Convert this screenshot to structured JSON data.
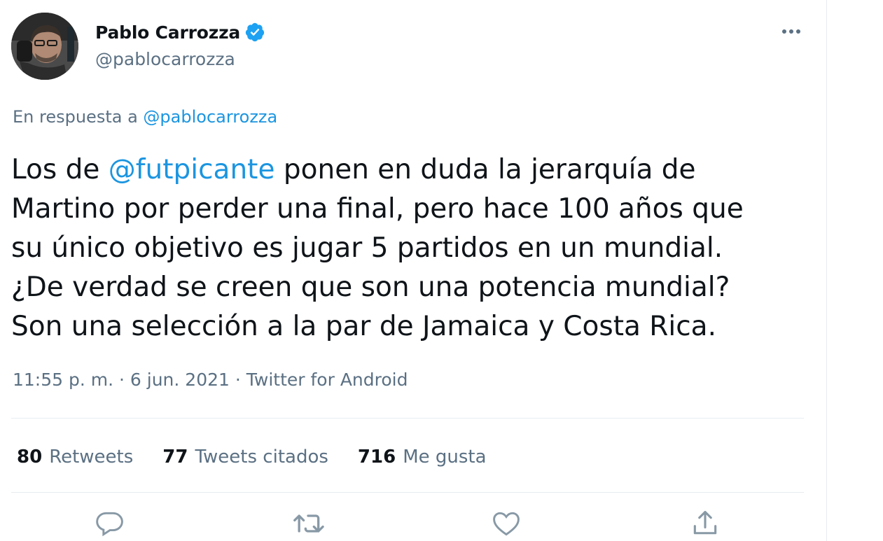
{
  "author": {
    "display_name": "Pablo Carrozza",
    "handle": "@pablocarrozza",
    "verified": true,
    "avatar_icon": "profile-photo"
  },
  "reply": {
    "prefix": "En respuesta a",
    "target": "@pablocarrozza"
  },
  "tweet": {
    "line1_before": "Los de ",
    "line1_mention": "@futpicante",
    "line1_after": " ponen en duda la jerarquía de",
    "line2": "Martino por perder una final, pero hace 100 años que",
    "line3": "su único objetivo es jugar 5 partidos en un mundial.",
    "line4": "¿De verdad se creen que son una potencia mundial?",
    "line5": "Son una selección a la par de Jamaica y Costa Rica."
  },
  "meta": {
    "time": "11:55 p. m.",
    "separator": " · ",
    "date": "6 jun. 2021",
    "source": "Twitter for Android"
  },
  "stats": {
    "retweets_count": "80",
    "retweets_label": "Retweets",
    "quotes_count": "77",
    "quotes_label": "Tweets citados",
    "likes_count": "716",
    "likes_label": "Me gusta"
  },
  "actions": [
    "reply-icon",
    "retweet-icon",
    "like-icon",
    "share-icon"
  ],
  "colors": {
    "link": "#1b95e0",
    "secondary_text": "#5b7083",
    "verified_badge": "#1da1f2",
    "divider": "#e6ecf0"
  }
}
